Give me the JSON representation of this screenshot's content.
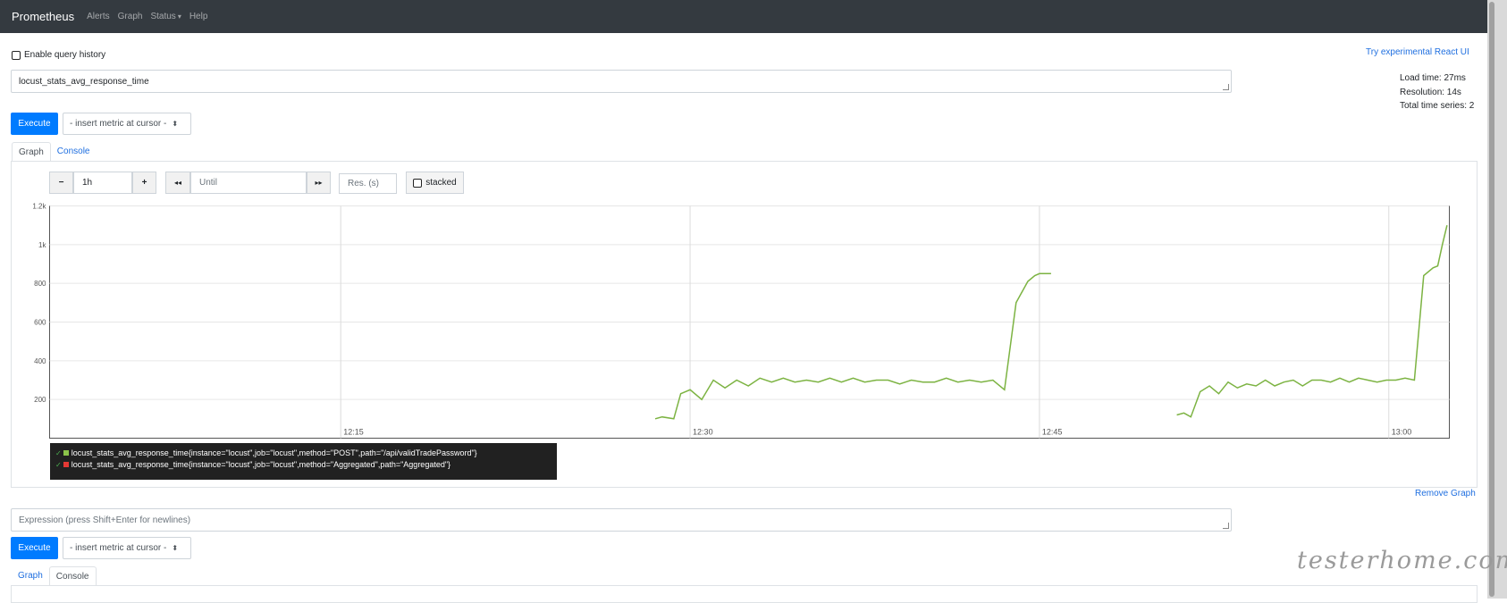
{
  "navbar": {
    "brand": "Prometheus",
    "links": [
      "Alerts",
      "Graph",
      "Status",
      "Help"
    ],
    "status_caret": "▾"
  },
  "query_history": {
    "label": "Enable query history",
    "checked": false
  },
  "react_ui_link": "Try experimental React UI",
  "stats": {
    "load_time": "Load time: 27ms",
    "resolution": "Resolution: 14s",
    "total_series": "Total time series: 2"
  },
  "panel1": {
    "expression": "locust_stats_avg_response_time",
    "execute_label": "Execute",
    "metric_select": "- insert metric at cursor -",
    "tabs": [
      "Graph",
      "Console"
    ],
    "active_tab": "Graph",
    "controls": {
      "minus": "−",
      "range": "1h",
      "plus": "+",
      "back": "◂◂",
      "until_placeholder": "Until",
      "forward": "▸▸",
      "res_placeholder": "Res. (s)",
      "stacked_label": "stacked"
    },
    "legend": [
      {
        "text": "locust_stats_avg_response_time{instance=\"locust\",job=\"locust\",method=\"POST\",path=\"/api/validTradePassword\"}",
        "color": "#8bc34a"
      },
      {
        "text": "locust_stats_avg_response_time{instance=\"locust\",job=\"locust\",method=\"Aggregated\",path=\"Aggregated\"}",
        "color": "#e53935"
      }
    ],
    "remove_graph": "Remove Graph"
  },
  "panel2": {
    "placeholder": "Expression (press Shift+Enter for newlines)",
    "execute_label": "Execute",
    "metric_select": "- insert metric at cursor -",
    "tabs": [
      "Graph",
      "Console"
    ],
    "active_tab": "Console"
  },
  "watermark": "testerhome.com",
  "chart_data": {
    "type": "line",
    "ylim": [
      0,
      1200
    ],
    "y_ticks": [
      "200",
      "400",
      "600",
      "800",
      "1k",
      "1.2k"
    ],
    "y_tick_values": [
      200,
      400,
      600,
      800,
      1000,
      1200
    ],
    "x_ticks": [
      "12:15",
      "12:30",
      "12:45",
      "13:00"
    ],
    "x_tick_minutes": [
      15,
      30,
      45,
      60
    ],
    "xlim_minutes": [
      2.5,
      62.6
    ],
    "series": [
      {
        "color": "#7cb342",
        "x_minutes": [
          28.5,
          28.8,
          29.3,
          29.6,
          30.0,
          30.5,
          31.0,
          31.5,
          32.0,
          32.5,
          33.0,
          33.5,
          34.0,
          34.5,
          35.0,
          35.5,
          36.0,
          36.5,
          37.0,
          37.5,
          38.0,
          38.5,
          39.0,
          39.5,
          40.0,
          40.5,
          41.0,
          41.5,
          42.0,
          42.5,
          43.0,
          43.5,
          44.0,
          44.5,
          44.8,
          45.0,
          45.2,
          45.5
        ],
        "values": [
          100,
          110,
          100,
          230,
          250,
          200,
          300,
          260,
          300,
          270,
          310,
          290,
          310,
          290,
          300,
          290,
          310,
          290,
          310,
          290,
          300,
          300,
          280,
          300,
          290,
          290,
          310,
          290,
          300,
          290,
          300,
          250,
          700,
          810,
          840,
          850,
          850,
          850
        ]
      },
      {
        "color": "#7cb342",
        "x_minutes": [
          50.9,
          51.2,
          51.5,
          51.9,
          52.3,
          52.7,
          53.1,
          53.5,
          53.9,
          54.3,
          54.7,
          55.1,
          55.5,
          55.9,
          56.3,
          56.7,
          57.1,
          57.5,
          57.9,
          58.3,
          58.7,
          59.1,
          59.5,
          59.9,
          60.3,
          60.7,
          61.1,
          61.5,
          61.9,
          62.1,
          62.3,
          62.5
        ],
        "values": [
          120,
          130,
          110,
          240,
          270,
          230,
          290,
          260,
          280,
          270,
          300,
          270,
          290,
          300,
          270,
          300,
          300,
          290,
          310,
          290,
          310,
          300,
          290,
          300,
          300,
          310,
          300,
          840,
          880,
          890,
          1000,
          1100
        ]
      }
    ]
  }
}
